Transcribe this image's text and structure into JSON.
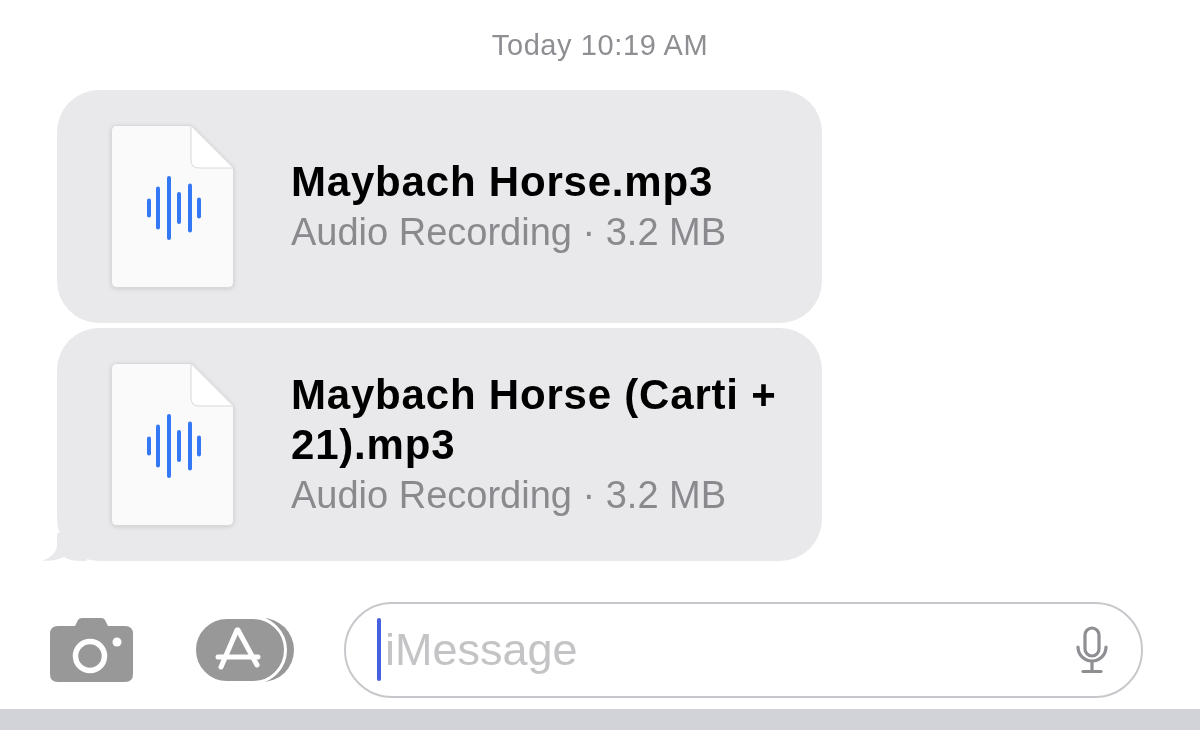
{
  "timestamp": "Today 10:19 AM",
  "messages": [
    {
      "title": "Maybach Horse.mp3",
      "subtitle": "Audio Recording · 3.2 MB",
      "tail": false
    },
    {
      "title": "Maybach Horse (Carti + 21).mp3",
      "subtitle": "Audio Recording · 3.2 MB",
      "tail": true
    }
  ],
  "composer": {
    "placeholder": "iMessage",
    "focused": true
  }
}
